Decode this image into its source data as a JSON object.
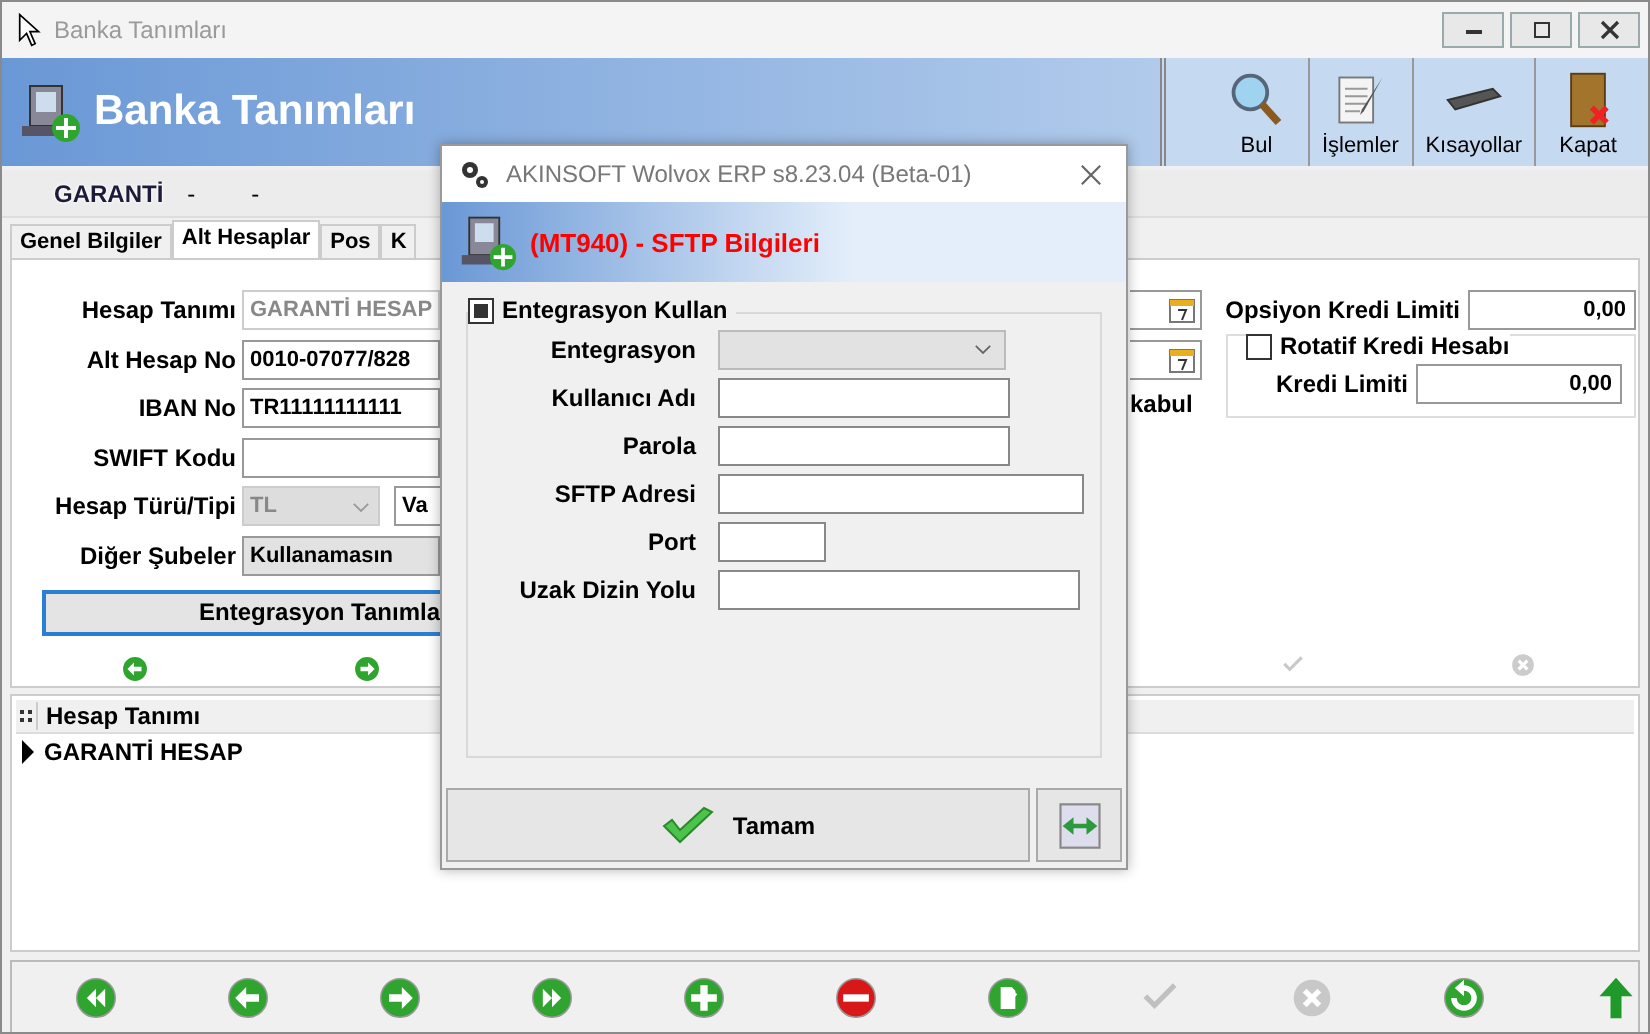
{
  "window": {
    "title": "Banka Tanımları"
  },
  "header": {
    "title": "Banka Tanımları"
  },
  "toolbar": [
    {
      "label": "Bul",
      "kind": "search"
    },
    {
      "label": "İşlemler",
      "kind": "document"
    },
    {
      "label": "Kısayollar",
      "kind": "keyboard"
    },
    {
      "label": "Kapat",
      "kind": "exit"
    }
  ],
  "bank_strip": [
    "GARANTİ",
    "-",
    "-"
  ],
  "tabs": [
    {
      "label": "Genel Bilgiler",
      "selected": false
    },
    {
      "label": "Alt Hesaplar",
      "selected": true
    },
    {
      "label": "Pos",
      "selected": false
    },
    {
      "label": "K",
      "selected": false
    }
  ],
  "form": [
    {
      "label": "Hesap Tanımı",
      "kind": "text",
      "value": "GARANTİ HESAP",
      "disabled": true
    },
    {
      "label": "Alt Hesap No",
      "kind": "text",
      "value": "0010-07077/828",
      "disabled": false
    },
    {
      "label": "IBAN No",
      "kind": "text",
      "value": "TR11111111111",
      "disabled": false
    },
    {
      "label": "SWIFT Kodu",
      "kind": "text",
      "disabled": false
    },
    {
      "label": "Hesap Türü/Tipi",
      "kind": "pair",
      "value": "TL",
      "value_2": "Va",
      "disabled": true
    },
    {
      "label": "Diğer Şubeler",
      "kind": "select",
      "value": "Kullanamasın",
      "disabled": false
    }
  ],
  "integration_button": "Entegrasyon Tanımla",
  "right_panel": {
    "cut_label": "kabul",
    "option_limit_label": "Opsiyon Kredi Limiti",
    "option_limit_value": "0,00",
    "revolving": {
      "label": "Rotatif Kredi Hesabı",
      "checked": false
    },
    "credit_limit_label": "Kredi Limiti",
    "credit_limit_value": "0,00"
  },
  "grid": {
    "columns": [
      "Hesap Tanımı"
    ],
    "rows": [
      {
        "cells": [
          "GARANTİ HESAP"
        ],
        "current": true
      }
    ]
  },
  "bottom_toolbar": [
    {
      "kind": "first",
      "disabled": false
    },
    {
      "kind": "prev",
      "disabled": false
    },
    {
      "kind": "next",
      "disabled": false
    },
    {
      "kind": "last",
      "disabled": false
    },
    {
      "kind": "add",
      "disabled": false
    },
    {
      "kind": "delete",
      "disabled": false
    },
    {
      "kind": "edit",
      "disabled": false
    },
    {
      "kind": "confirm",
      "disabled": true
    },
    {
      "kind": "cancel",
      "disabled": true
    },
    {
      "kind": "refresh",
      "disabled": false
    },
    {
      "kind": "up",
      "disabled": false
    }
  ],
  "dialog": {
    "title": "AKINSOFT Wolvox ERP s8.23.04 (Beta-01)",
    "heading": "(MT940) - SFTP Bilgileri",
    "use_integration": {
      "label": "Entegrasyon Kullan",
      "checked": true
    },
    "fields": [
      {
        "label": "Entegrasyon",
        "kind": "select",
        "disabled": true
      },
      {
        "label": "Kullanıcı Adı",
        "kind": "text",
        "disabled": false
      },
      {
        "label": "Parola",
        "kind": "text",
        "disabled": false
      },
      {
        "label": "SFTP Adresi",
        "kind": "text",
        "disabled": false
      },
      {
        "label": "Port",
        "kind": "text",
        "disabled": false
      },
      {
        "label": "Uzak Dizin Yolu",
        "kind": "text",
        "disabled": false
      }
    ],
    "ok_button": "Tamam"
  }
}
